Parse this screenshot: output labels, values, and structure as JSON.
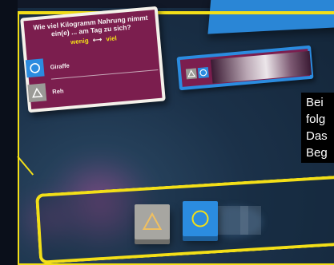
{
  "question_card": {
    "question": "Wie viel Kilogramm Nahrung nimmt ein(e) ... am Tag zu sich?",
    "scale_low": "wenig",
    "scale_arrow": "⟷",
    "scale_high": "viel",
    "answers": [
      {
        "symbol": "circle-icon",
        "color": "#2b8ce0",
        "label": "Giraffe"
      },
      {
        "symbol": "triangle-icon",
        "color": "#9a9a96",
        "label": "Reh"
      }
    ]
  },
  "subtitle": {
    "lines": [
      "Bei",
      "folg",
      "Das",
      "Beg"
    ]
  },
  "colors": {
    "frame": "#f3df18",
    "card": "#7b1e4e",
    "blue": "#2b8ce0",
    "grey": "#a7a6a1"
  },
  "tray": {
    "tiles": [
      {
        "symbol": "triangle-icon",
        "color": "#a7a6a1"
      },
      {
        "symbol": "circle-icon",
        "color": "#2b8ce0"
      }
    ]
  }
}
